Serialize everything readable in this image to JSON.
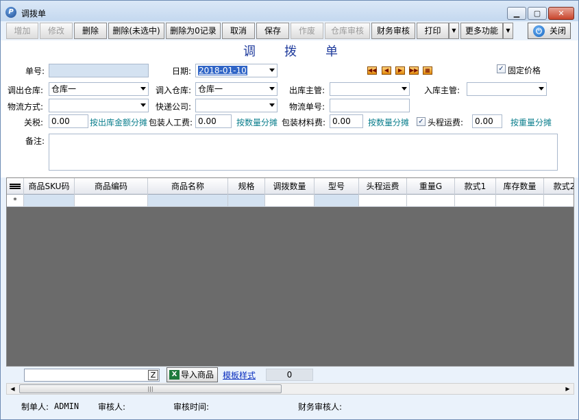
{
  "window": {
    "title": "调拨单",
    "app_icon": "P",
    "minimize_glyph": "▁",
    "maximize_glyph": "▢",
    "close_glyph": "✕"
  },
  "toolbar": {
    "add": "增加",
    "edit": "修改",
    "delete": "删除",
    "delete_unselected": "删除(未选中)",
    "delete_zero": "删除为0记录",
    "cancel": "取消",
    "save": "保存",
    "void": "作废",
    "warehouse_audit": "仓库审核",
    "finance_audit": "财务审核",
    "print": "打印",
    "more": "更多功能",
    "close": "关闭",
    "dropdown_glyph": "▼"
  },
  "form": {
    "doc_title_chars": [
      "调",
      "拨",
      "单"
    ],
    "order_no_label": "单号:",
    "order_no_value": "",
    "date_label": "日期:",
    "date_value": "2018-01-10",
    "fixed_price_label": "固定价格",
    "fixed_price_checked": "✓",
    "out_wh_label": "调出仓库:",
    "out_wh_value": "仓库一",
    "in_wh_label": "调入仓库:",
    "in_wh_value": "仓库一",
    "out_manager_label": "出库主管:",
    "out_manager_value": "",
    "in_manager_label": "入库主管:",
    "in_manager_value": "",
    "logistics_label": "物流方式:",
    "logistics_value": "",
    "courier_label": "快递公司:",
    "courier_value": "",
    "tracking_label": "物流单号:",
    "tracking_value": "",
    "tax_label": "关税:",
    "tax_value": "0.00",
    "tax_link": "按出库金额分摊",
    "packing_labor_label": "包装人工费:",
    "packing_labor_value": "0.00",
    "packing_labor_link": "按数量分摊",
    "packing_mat_label": "包装材料费:",
    "packing_mat_value": "0.00",
    "packing_mat_link": "按数量分摊",
    "first_leg_label": "头程运费:",
    "first_leg_checked": "✓",
    "first_leg_value": "0.00",
    "first_leg_link": "按重量分摊",
    "remark_label": "备注:",
    "nav": {
      "first": "◀◀",
      "prev": "◀",
      "next": "▶",
      "last": "▶▶",
      "grid": "▦"
    }
  },
  "grid": {
    "columns": [
      "商品SKU码",
      "商品编码",
      "商品名称",
      "规格",
      "调拨数量",
      "型号",
      "头程运费",
      "重量G",
      "款式1",
      "库存数量",
      "款式2"
    ],
    "new_row_marker": "*"
  },
  "bottom": {
    "search_go": "Z",
    "import_label": "导入商品",
    "excel_glyph": "X",
    "template_link": "模板样式",
    "count": "0"
  },
  "scrollbar": {
    "left": "◀",
    "right": "▶",
    "grip": "|||"
  },
  "footer": {
    "creator_label": "制单人:",
    "creator_value": "ADMIN",
    "auditor_label": "审核人:",
    "audit_time_label": "审核时间:",
    "finance_auditor_label": "财务审核人:"
  },
  "colors": {
    "window_bg": "#eaf2fb",
    "title_accent": "#1f3b9c",
    "link_green": "#0a7e8c",
    "grid_body": "#6b6b6b",
    "selected_date": "#2f64c6"
  }
}
